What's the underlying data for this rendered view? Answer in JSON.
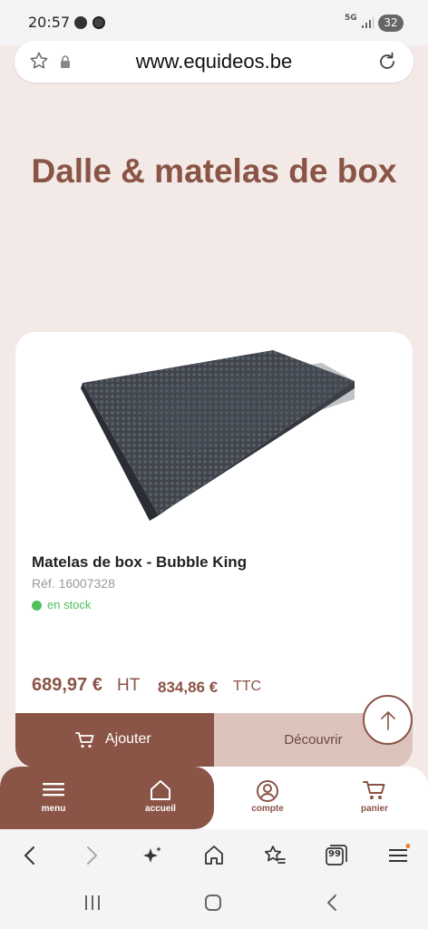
{
  "status_bar": {
    "time": "20:57",
    "network": "5G",
    "battery": "32",
    "icons": [
      "messenger-icon",
      "football-icon",
      "signal-icon",
      "battery-icon"
    ]
  },
  "url_bar": {
    "url": "www.equideos.be",
    "icons": [
      "star-icon",
      "lock-icon",
      "reload-icon"
    ]
  },
  "page": {
    "title": "Dalle & matelas de box"
  },
  "product": {
    "name": "Matelas de box - Bubble King",
    "reference": "Réf. 16007328",
    "stock_status": "en stock",
    "price_ht": "689,97 €",
    "price_ht_label": "HT",
    "price_ttc": "834,86 €",
    "price_ttc_label": "TTC",
    "add_button_label": "Ajouter",
    "discover_button_label": "Découvrir"
  },
  "bottom_nav": {
    "items": [
      {
        "label": "menu",
        "icon": "hamburger-icon"
      },
      {
        "label": "accueil",
        "icon": "home-icon"
      },
      {
        "label": "compte",
        "icon": "user-icon"
      },
      {
        "label": "panier",
        "icon": "cart-icon"
      }
    ]
  },
  "browser_toolbar": {
    "tabs_count": "99",
    "icons": [
      "back-icon",
      "forward-icon",
      "sparkle-icon",
      "home-icon",
      "bookmarks-icon",
      "tabs-icon",
      "menu-icon"
    ]
  },
  "colors": {
    "brand": "#8a5446",
    "page_background": "#f3e9e6",
    "secondary_button": "#dcc4bd",
    "stock_green": "#4fc25b"
  }
}
